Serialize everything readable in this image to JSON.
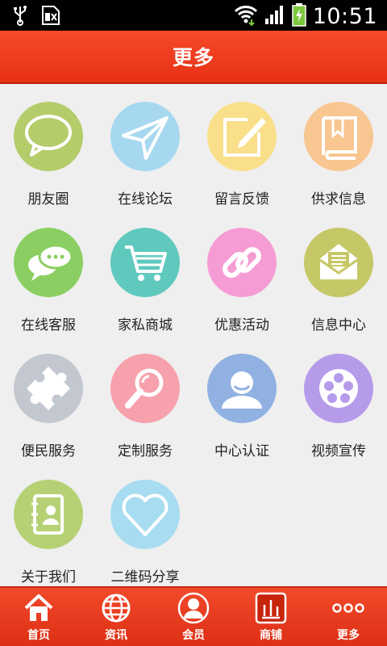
{
  "status_bar": {
    "time": "10:51"
  },
  "header": {
    "title": "更多"
  },
  "grid": [
    {
      "label": "朋友圈",
      "color": "#b5cc6a",
      "icon": "speech-bubble-icon"
    },
    {
      "label": "在线论坛",
      "color": "#a6d8f0",
      "icon": "paper-plane-icon"
    },
    {
      "label": "留言反馈",
      "color": "#f9df8a",
      "icon": "edit-note-icon"
    },
    {
      "label": "供求信息",
      "color": "#f8c690",
      "icon": "book-icon"
    },
    {
      "label": "在线客服",
      "color": "#8bcf62",
      "icon": "chat-bubbles-icon"
    },
    {
      "label": "家私商城",
      "color": "#5fc9bd",
      "icon": "shopping-cart-icon"
    },
    {
      "label": "优惠活动",
      "color": "#f69cd4",
      "icon": "link-icon"
    },
    {
      "label": "信息中心",
      "color": "#c6c766",
      "icon": "envelope-icon"
    },
    {
      "label": "便民服务",
      "color": "#c3c8d0",
      "icon": "puzzle-icon"
    },
    {
      "label": "定制服务",
      "color": "#f7a1ac",
      "icon": "magnifier-icon"
    },
    {
      "label": "中心认证",
      "color": "#90b1e2",
      "icon": "user-icon"
    },
    {
      "label": "视频宣传",
      "color": "#b59be9",
      "icon": "film-reel-icon"
    },
    {
      "label": "关于我们",
      "color": "#b5d174",
      "icon": "contacts-book-icon"
    },
    {
      "label": "二维码分享",
      "color": "#a8dcf1",
      "icon": "heart-icon"
    }
  ],
  "bottom_nav": [
    {
      "label": "首页",
      "icon": "home-icon"
    },
    {
      "label": "资讯",
      "icon": "globe-icon"
    },
    {
      "label": "会员",
      "icon": "member-icon"
    },
    {
      "label": "商铺",
      "icon": "shop-chart-icon"
    },
    {
      "label": "更多",
      "icon": "more-dots-icon"
    }
  ]
}
